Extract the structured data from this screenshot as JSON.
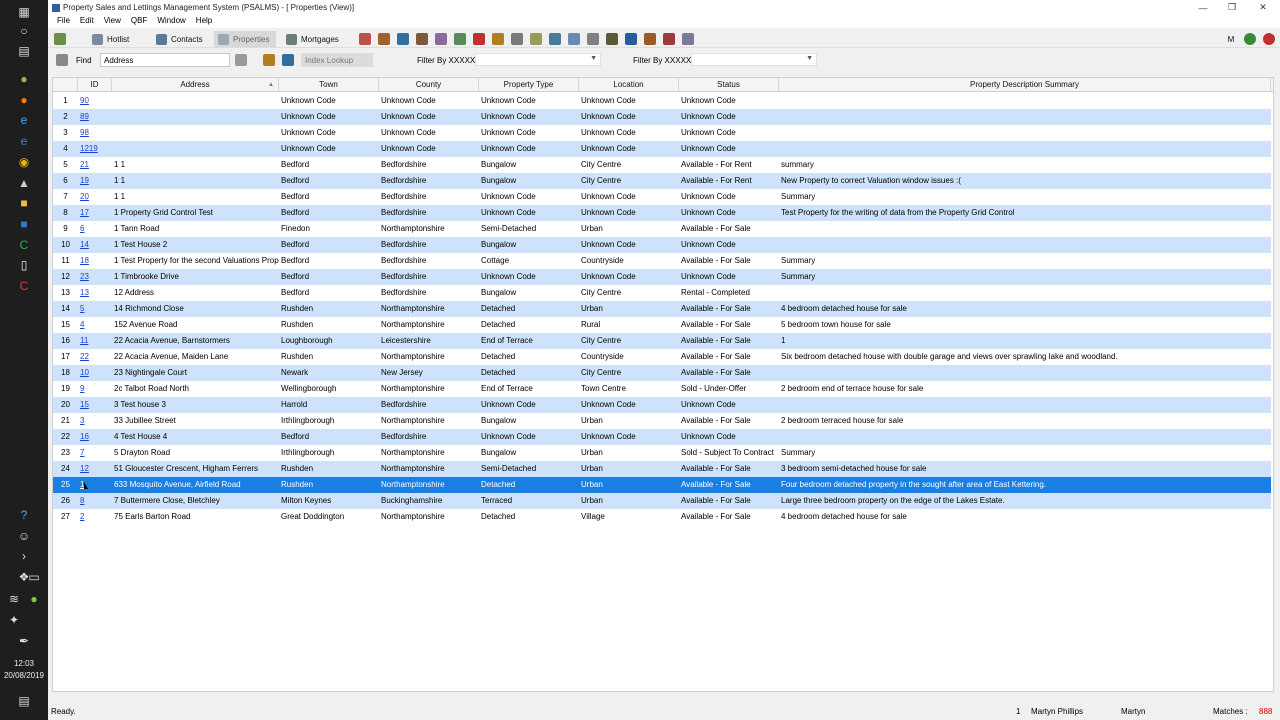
{
  "window": {
    "title": "Property Sales and Lettings Management System (PSALMS) - [ Properties (View)]"
  },
  "menu": [
    "File",
    "Edit",
    "View",
    "QBF",
    "Window",
    "Help"
  ],
  "toolbar": {
    "hotlist": "Hotlist",
    "contacts": "Contacts",
    "properties": "Properties",
    "mortgages": "Mortgages",
    "m_label": "M"
  },
  "findbar": {
    "find_label": "Find",
    "find_value": "Address",
    "index_lookup": "Index Lookup",
    "filter1_label": "Filter By XXXXX",
    "filter2_label": "Filter By XXXXX"
  },
  "grid": {
    "columns": [
      "ID",
      "Address",
      "Town",
      "County",
      "Property Type",
      "Location",
      "Status",
      "Property Description Summary"
    ],
    "rows": [
      [
        "1",
        "90",
        "",
        "Unknown Code",
        "Unknown Code",
        "Unknown Code",
        "Unknown Code",
        "Unknown Code",
        ""
      ],
      [
        "2",
        "89",
        "",
        "Unknown Code",
        "Unknown Code",
        "Unknown Code",
        "Unknown Code",
        "Unknown Code",
        ""
      ],
      [
        "3",
        "98",
        "",
        "Unknown Code",
        "Unknown Code",
        "Unknown Code",
        "Unknown Code",
        "Unknown Code",
        ""
      ],
      [
        "4",
        "1219",
        "",
        "Unknown Code",
        "Unknown Code",
        "Unknown Code",
        "Unknown Code",
        "Unknown Code",
        ""
      ],
      [
        "5",
        "21",
        "1 1",
        "Bedford",
        "Bedfordshire",
        "Bungalow",
        "City Centre",
        "Available - For Rent",
        "summary"
      ],
      [
        "6",
        "19",
        "1 1",
        "Bedford",
        "Bedfordshire",
        "Bungalow",
        "City Centre",
        "Available - For Rent",
        "New Property to correct Valuation window issues :("
      ],
      [
        "7",
        "20",
        "1 1",
        "Bedford",
        "Bedfordshire",
        "Unknown Code",
        "Unknown Code",
        "Unknown Code",
        "Summary"
      ],
      [
        "8",
        "17",
        "1 Property Grid Control Test",
        "Bedford",
        "Bedfordshire",
        "Unknown Code",
        "Unknown Code",
        "Unknown Code",
        "Test Property for the writing of data from the Property Grid Control"
      ],
      [
        "9",
        "6",
        "1 Tann Road",
        "Finedon",
        "Northamptonshire",
        "Semi-Detached",
        "Urban",
        "Available - For Sale",
        ""
      ],
      [
        "10",
        "14",
        "1 Test House 2",
        "Bedford",
        "Bedfordshire",
        "Bungalow",
        "Unknown Code",
        "Unknown Code",
        ""
      ],
      [
        "11",
        "18",
        "1 Test Property for the second Valuations Prop",
        "Bedford",
        "Bedfordshire",
        "Cottage",
        "Countryside",
        "Available - For Sale",
        "Summary"
      ],
      [
        "12",
        "23",
        "1 Timbrooke Drive",
        "Bedford",
        "Bedfordshire",
        "Unknown Code",
        "Unknown Code",
        "Unknown Code",
        "Summary"
      ],
      [
        "13",
        "13",
        "12 Address",
        "Bedford",
        "Bedfordshire",
        "Bungalow",
        "City Centre",
        "Rental - Completed",
        ""
      ],
      [
        "14",
        "5",
        "14 Richmond Close",
        "Rushden",
        "Northamptonshire",
        "Detached",
        "Urban",
        "Available - For Sale",
        "4 bedroom detached house for sale"
      ],
      [
        "15",
        "4",
        "152 Avenue Road",
        "Rushden",
        "Northamptonshire",
        "Detached",
        "Rural",
        "Available - For Sale",
        "5 bedroom town house for sale"
      ],
      [
        "16",
        "11",
        "22 Acacia Avenue, Barnstormers",
        "Loughborough",
        "Leicestershire",
        "End of Terrace",
        "City Centre",
        "Available - For Sale",
        "1"
      ],
      [
        "17",
        "22",
        "22 Acacia Avenue, Maiden Lane",
        "Rushden",
        "Northamptonshire",
        "Detached",
        "Countryside",
        "Available - For Sale",
        "Six bedroom detached house with double garage and views over sprawling lake and woodland."
      ],
      [
        "18",
        "10",
        "23 Nightingale Court",
        "Newark",
        "New Jersey",
        "Detached",
        "City Centre",
        "Available - For Sale",
        ""
      ],
      [
        "19",
        "9",
        "2c Talbot Road North",
        "Wellingborough",
        "Northamptonshire",
        "End of Terrace",
        "Town Centre",
        "Sold - Under-Offer",
        "2 bedroom end of terrace house for sale"
      ],
      [
        "20",
        "15",
        "3 Test house 3",
        "Harrold",
        "Bedfordshire",
        "Unknown Code",
        "Unknown Code",
        "Unknown Code",
        ""
      ],
      [
        "21",
        "3",
        "33 Jubillee Street",
        "Irthlingborough",
        "Northamptonshire",
        "Bungalow",
        "Urban",
        "Available - For Sale",
        "2 bedroom terraced house for sale"
      ],
      [
        "22",
        "16",
        "4 Test House 4",
        "Bedford",
        "Bedfordshire",
        "Unknown Code",
        "Unknown Code",
        "Unknown Code",
        ""
      ],
      [
        "23",
        "7",
        "5 Drayton Road",
        "Irthlingborough",
        "Northamptonshire",
        "Bungalow",
        "Urban",
        "Sold - Subject To Contract",
        "Summary"
      ],
      [
        "24",
        "12",
        "51 Gloucester Crescent, Higham Ferrers",
        "Rushden",
        "Northamptonshire",
        "Semi-Detached",
        "Urban",
        "Available - For Sale",
        "3 bedroom semi-detached house for sale"
      ],
      [
        "25",
        "1",
        "633 Mosquito Avenue, Airfield Road",
        "Rushden",
        "Northamptonshire",
        "Detached",
        "Urban",
        "Available - For Sale",
        "Four bedroom detached property in the sought after area of East Kettering."
      ],
      [
        "26",
        "8",
        "7 Buttermere Close, Bletchley",
        "Milton Keynes",
        "Buckinghamshire",
        "Terraced",
        "Urban",
        "Available - For Sale",
        "Large three bedroom property on the edge of the Lakes Estate."
      ],
      [
        "27",
        "2",
        "75 Earls Barton Road",
        "Great Doddington",
        "Northamptonshire",
        "Detached",
        "Village",
        "Available - For Sale",
        "4 bedroom detached house for sale"
      ]
    ],
    "selected_row": 24
  },
  "status": {
    "ready": "Ready.",
    "count": "1",
    "user_full": "Martyn Phillips",
    "user_short": "Martyn",
    "matches_label": "Matches :",
    "matches_value": "888"
  },
  "clock": {
    "time": "12:03",
    "date": "20/08/2019"
  },
  "colors": {
    "selected_row": "#1a7fe3",
    "alt_row": "#cfe2fb",
    "link": "#1a3fd4",
    "matches_value": "#d00000"
  }
}
